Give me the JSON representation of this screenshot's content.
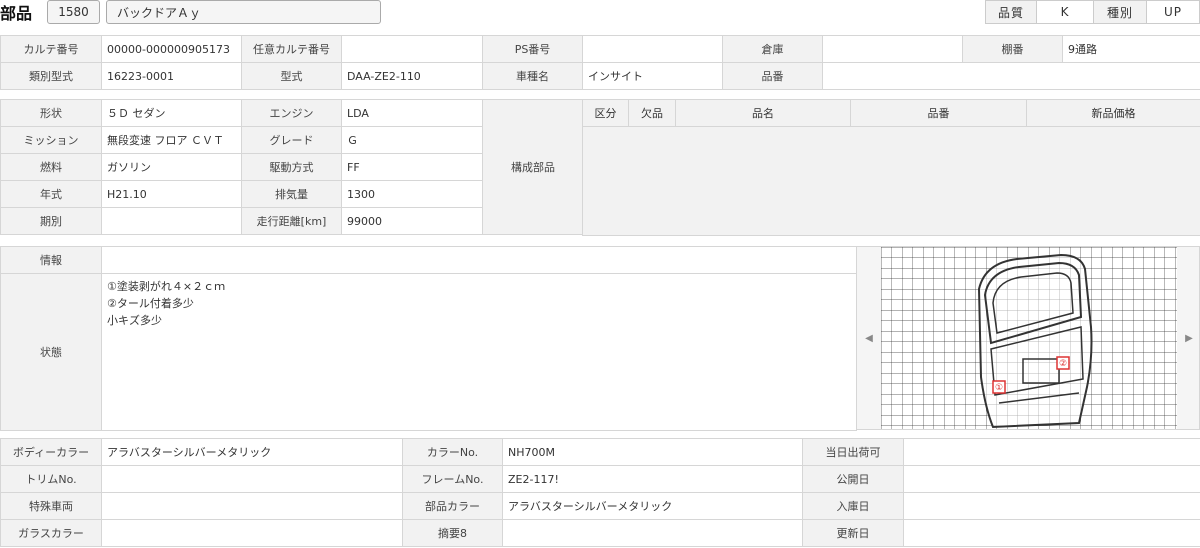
{
  "header": {
    "title": "部品",
    "code": "1580",
    "part_name": "バックドアＡｙ",
    "quality_label": "品質",
    "quality_value": "K",
    "kind_label": "種別",
    "kind_value": "UP"
  },
  "row1": {
    "karte_label": "カルテ番号",
    "karte_value": "00000-000000905173",
    "nini_label": "任意カルテ番号",
    "nini_value": "",
    "ps_label": "PS番号",
    "ps_value": "",
    "souko_label": "倉庫",
    "souko_value": "",
    "tana_label": "棚番",
    "tana_value": "9通路"
  },
  "row2": {
    "ruibetsu_label": "類別型式",
    "ruibetsu_value": "16223-0001",
    "katashiki_label": "型式",
    "katashiki_value": "DAA-ZE2-110",
    "shamei_label": "車種名",
    "shamei_value": "インサイト",
    "hinban_label": "品番",
    "hinban_value": ""
  },
  "spec": {
    "keijo_label": "形状",
    "keijo_value": "５Ｄ セダン",
    "engine_label": "エンジン",
    "engine_value": "LDA",
    "mission_label": "ミッション",
    "mission_value": "無段変速 フロア ＣＶＴ",
    "grade_label": "グレード",
    "grade_value": "Ｇ",
    "nenryo_label": "燃料",
    "nenryo_value": "ガソリン",
    "kudo_label": "駆動方式",
    "kudo_value": "FF",
    "nenshiki_label": "年式",
    "nenshiki_value": "H21.10",
    "haikiryo_label": "排気量",
    "haikiryo_value": "1300",
    "kibetsu_label": "期別",
    "kibetsu_value": "",
    "soko_label": "走行距離[km]",
    "soko_value": "99000",
    "kosei_label": "構成部品"
  },
  "parts_table": {
    "headers": [
      "区分",
      "欠品",
      "品名",
      "品番",
      "新品価格"
    ]
  },
  "info": {
    "joho_label": "情報",
    "joho_value": "",
    "jotai_label": "状態",
    "jotai_lines": [
      "①塗装剥がれ４×２ｃｍ",
      "②タール付着多少",
      "小キズ多少"
    ]
  },
  "viewer": {
    "left_arrow": "◀",
    "right_arrow": "▶",
    "marker1": "①",
    "marker2": "②"
  },
  "bottom": {
    "body_color_label": "ボディーカラー",
    "body_color_value": "アラバスターシルバーメタリック",
    "color_no_label": "カラーNo.",
    "color_no_value": "NH700M",
    "toujitsu_label": "当日出荷可",
    "toujitsu_value": "",
    "trim_label": "トリムNo.",
    "trim_value": "",
    "frame_label": "フレームNo.",
    "frame_value": "ZE2-117!",
    "koukai_label": "公開日",
    "koukai_value": "",
    "tokushu_label": "特殊車両",
    "tokushu_value": "",
    "parts_color_label": "部品カラー",
    "parts_color_value": "アラバスターシルバーメタリック",
    "nyuko_label": "入庫日",
    "nyuko_value": "",
    "glass_label": "ガラスカラー",
    "glass_value": "",
    "tekiyo_label": "摘要8",
    "tekiyo_value": "",
    "koshin_label": "更新日",
    "koshin_value": ""
  }
}
